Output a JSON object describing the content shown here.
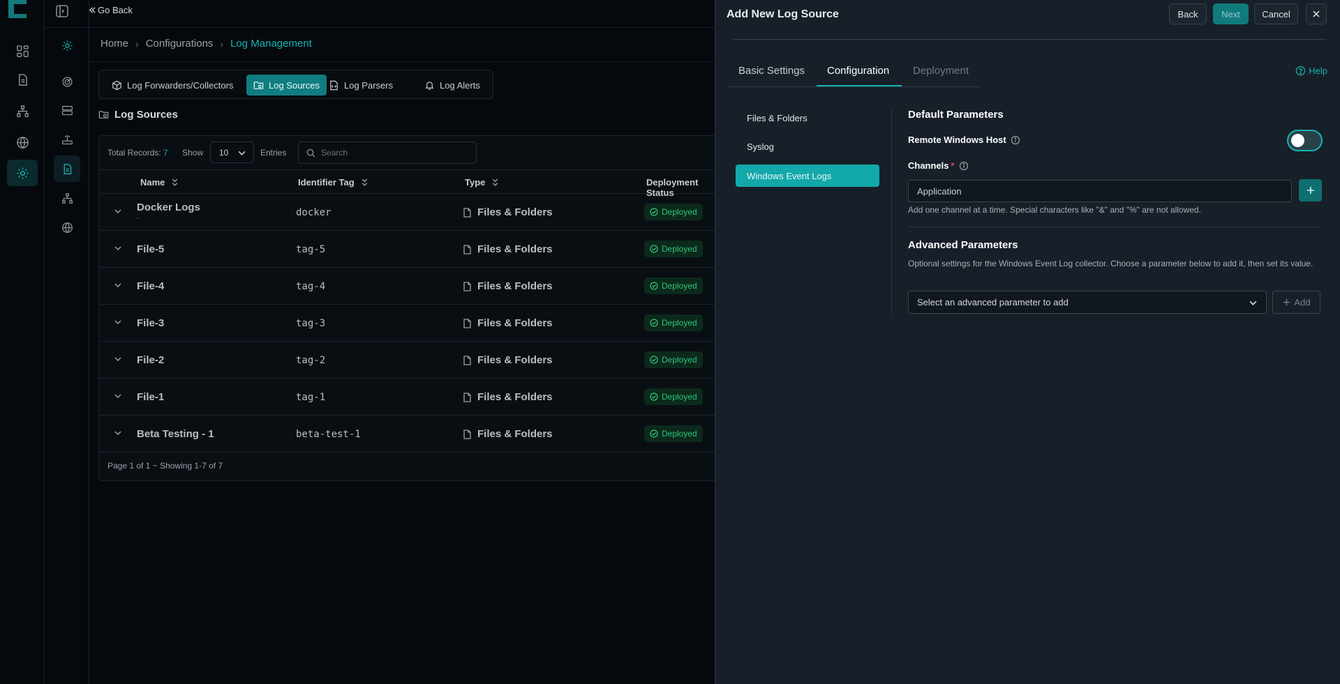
{
  "nav": {
    "go_back": "Go Back"
  },
  "breadcrumb": [
    "Home",
    "Configurations",
    "Log Management"
  ],
  "tabs": [
    {
      "label": "Log Forwarders/Collectors",
      "icon": "cube-icon"
    },
    {
      "label": "Log Sources",
      "icon": "folder-icon"
    },
    {
      "label": "Log Parsers",
      "icon": "file-code-icon"
    },
    {
      "label": "Log Alerts",
      "icon": "bell-icon"
    }
  ],
  "section_title": "Log Sources",
  "toolbar": {
    "total_label": "Total Records:",
    "total_value": "7",
    "show_label": "Show",
    "page_size": "10",
    "entries_label": "Entries",
    "search_placeholder": "Search"
  },
  "columns": [
    "Name",
    "Identifier Tag",
    "Type",
    "Deployment Status"
  ],
  "rows": [
    {
      "name": "Docker Logs",
      "sub": "-",
      "tag": "docker",
      "type": "Files & Folders",
      "status": "Deployed"
    },
    {
      "name": "File-5",
      "tag": "tag-5",
      "type": "Files & Folders",
      "status": "Deployed"
    },
    {
      "name": "File-4",
      "tag": "tag-4",
      "type": "Files & Folders",
      "status": "Deployed"
    },
    {
      "name": "File-3",
      "tag": "tag-3",
      "type": "Files & Folders",
      "status": "Deployed"
    },
    {
      "name": "File-2",
      "tag": "tag-2",
      "type": "Files & Folders",
      "status": "Deployed"
    },
    {
      "name": "File-1",
      "tag": "tag-1",
      "type": "Files & Folders",
      "status": "Deployed"
    },
    {
      "name": "Beta Testing - 1",
      "tag": "beta-test-1",
      "type": "Files & Folders",
      "status": "Deployed"
    }
  ],
  "pagination": "Page 1 of 1 ~ Showing 1-7 of 7",
  "drawer": {
    "title": "Add New Log Source",
    "buttons": {
      "back": "Back",
      "next": "Next",
      "cancel": "Cancel"
    },
    "tabs": {
      "basic": "Basic Settings",
      "config": "Configuration",
      "deploy": "Deployment"
    },
    "help": "Help",
    "source_types": [
      "Files & Folders",
      "Syslog",
      "Windows Event Logs"
    ],
    "default_params_title": "Default Parameters",
    "remote_host_label": "Remote Windows Host",
    "remote_host_enabled": false,
    "channels_label": "Channels",
    "required_mark": "*",
    "channel_value": "Application",
    "channel_hint": "Add one channel at a time. Special characters like \"&\" and \"%\" are not allowed.",
    "advanced_title": "Advanced Parameters",
    "advanced_desc": "Optional settings for the Windows Event Log collector. Choose a parameter below to add it, then set its value.",
    "advanced_placeholder": "Select an advanced parameter to add",
    "add_label": "Add"
  },
  "colors": {
    "accent": "#14b3b3",
    "deployed": "#2fc27a",
    "background": "#05090d",
    "drawer": "#172029"
  }
}
